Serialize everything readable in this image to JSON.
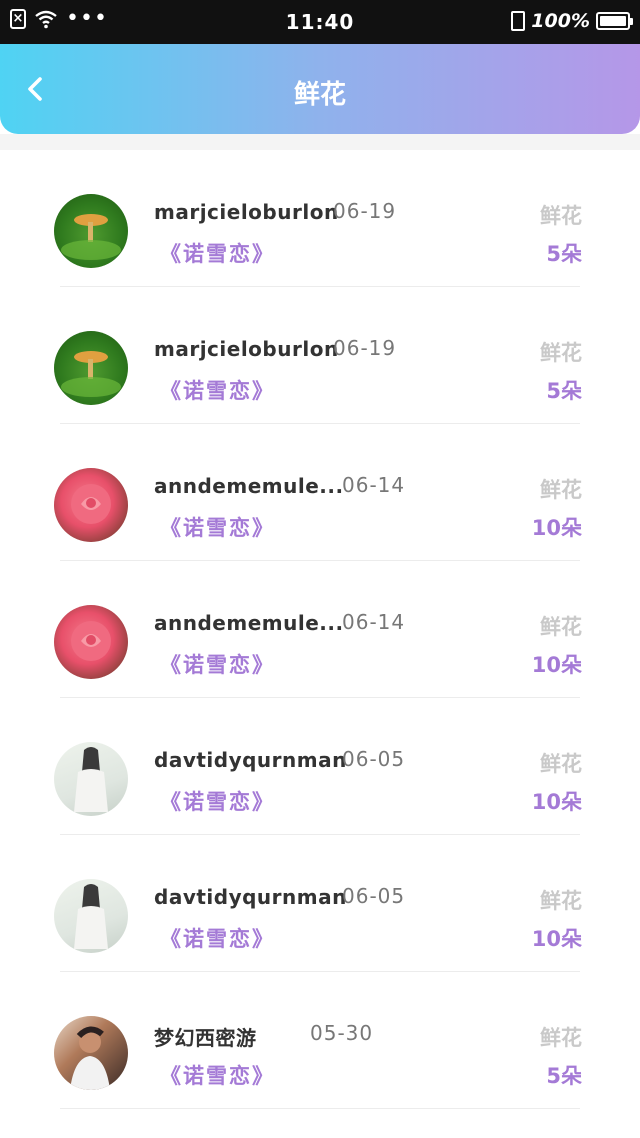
{
  "status_bar": {
    "time": "11:40",
    "battery": "100%"
  },
  "header": {
    "title": "鲜花",
    "back_icon": "chevron-left-icon"
  },
  "list": [
    {
      "name": "marjcieloburlon",
      "date": "06-19",
      "tag": "《诺雪恋》",
      "kind": "鲜花",
      "count": "5朵",
      "avatar": "mushroom-avatar"
    },
    {
      "name": "marjcieloburlon",
      "date": "06-19",
      "tag": "《诺雪恋》",
      "kind": "鲜花",
      "count": "5朵",
      "avatar": "mushroom-avatar"
    },
    {
      "name": "anndememule...",
      "date": "06-14",
      "tag": "《诺雪恋》",
      "kind": "鲜花",
      "count": "10朵",
      "avatar": "rose-avatar"
    },
    {
      "name": "anndememule...",
      "date": "06-14",
      "tag": "《诺雪恋》",
      "kind": "鲜花",
      "count": "10朵",
      "avatar": "rose-avatar"
    },
    {
      "name": "davtidyqurnman",
      "date": "06-05",
      "tag": "《诺雪恋》",
      "kind": "鲜花",
      "count": "10朵",
      "avatar": "girl-avatar"
    },
    {
      "name": "davtidyqurnman",
      "date": "06-05",
      "tag": "《诺雪恋》",
      "kind": "鲜花",
      "count": "10朵",
      "avatar": "girl-avatar"
    },
    {
      "name": "梦幻西密游",
      "date": "05-30",
      "tag": "《诺雪恋》",
      "kind": "鲜花",
      "count": "5朵",
      "avatar": "man-avatar"
    }
  ]
}
